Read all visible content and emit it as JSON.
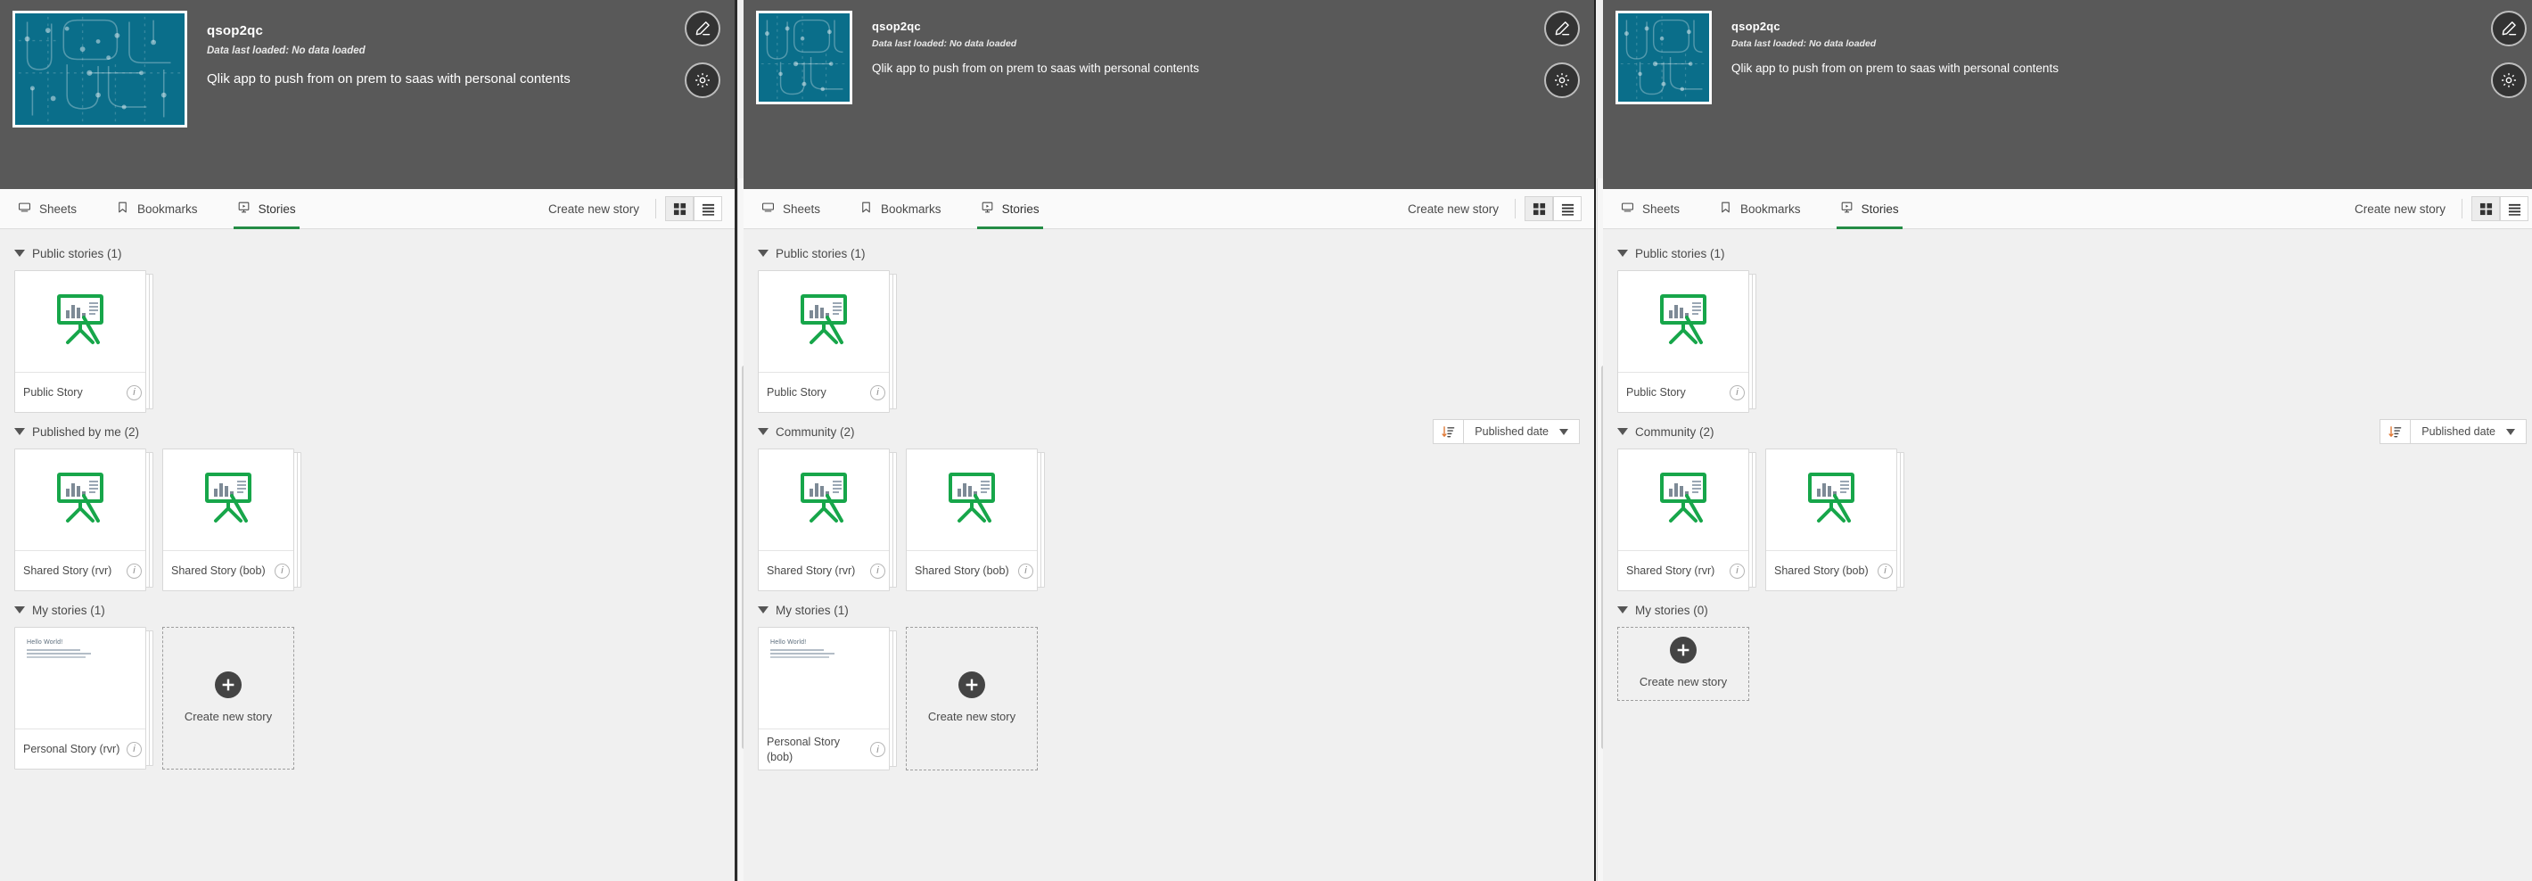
{
  "app": {
    "name": "qsop2qc",
    "data_loaded": "Data last loaded: No data loaded",
    "description": "Qlik app to push from on prem to saas with personal contents",
    "thumbnail_color": "#0a6e8a",
    "edit_button": "edit-app",
    "settings_button": "app-settings"
  },
  "tabs": {
    "sheets": "Sheets",
    "bookmarks": "Bookmarks",
    "stories": "Stories",
    "active": "Stories"
  },
  "toolbar": {
    "create_new_story": "Create new story",
    "grid_view": "grid-view",
    "list_view": "list-view",
    "active_view": "grid"
  },
  "sort": {
    "label": "Published date",
    "direction": "descending"
  },
  "accent_color": "#248c45",
  "header_bg": "#595959",
  "panels": [
    {
      "id": "panel-1",
      "sections": [
        {
          "title": "Public stories (1)",
          "has_sort": false,
          "cards": [
            {
              "label": "Public Story",
              "thumb": "easel",
              "info": "i"
            }
          ],
          "show_create": false
        },
        {
          "title": "Published by me (2)",
          "has_sort": false,
          "cards": [
            {
              "label": "Shared Story (rvr)",
              "thumb": "easel",
              "info": "i"
            },
            {
              "label": "Shared Story (bob)",
              "thumb": "easel",
              "info": "i"
            }
          ],
          "show_create": false
        },
        {
          "title": "My stories (1)",
          "has_sort": false,
          "cards": [
            {
              "label": "Personal Story (rvr)",
              "thumb": "slide",
              "info": "i",
              "slide_title": "Hello World!"
            }
          ],
          "show_create": true,
          "create_label": "Create new story"
        }
      ]
    },
    {
      "id": "panel-2",
      "sections": [
        {
          "title": "Public stories (1)",
          "has_sort": false,
          "cards": [
            {
              "label": "Public Story",
              "thumb": "easel",
              "info": "i"
            }
          ],
          "show_create": false
        },
        {
          "title": "Community (2)",
          "has_sort": true,
          "cards": [
            {
              "label": "Shared Story (rvr)",
              "thumb": "easel",
              "info": "i"
            },
            {
              "label": "Shared Story (bob)",
              "thumb": "easel",
              "info": "i"
            }
          ],
          "show_create": false
        },
        {
          "title": "My stories (1)",
          "has_sort": false,
          "cards": [
            {
              "label": "Personal Story (bob)",
              "thumb": "slide",
              "info": "i",
              "slide_title": "Hello World!"
            }
          ],
          "show_create": true,
          "create_label": "Create new story"
        }
      ]
    },
    {
      "id": "panel-3",
      "sections": [
        {
          "title": "Public stories (1)",
          "has_sort": false,
          "cards": [
            {
              "label": "Public Story",
              "thumb": "easel",
              "info": "i"
            }
          ],
          "show_create": false
        },
        {
          "title": "Community (2)",
          "has_sort": true,
          "cards": [
            {
              "label": "Shared Story (rvr)",
              "thumb": "easel",
              "info": "i"
            },
            {
              "label": "Shared Story (bob)",
              "thumb": "easel",
              "info": "i"
            }
          ],
          "show_create": false
        },
        {
          "title": "My stories (0)",
          "has_sort": false,
          "cards": [],
          "show_create": true,
          "create_label": "Create new story"
        }
      ]
    }
  ]
}
